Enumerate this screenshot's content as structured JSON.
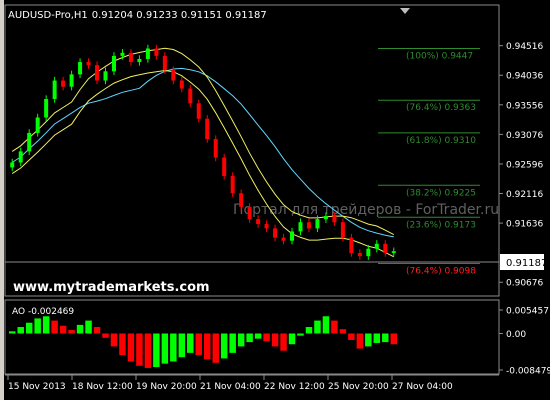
{
  "header": {
    "symbol": "AUDUSD-Pro,H1",
    "quotes": "0.91204 0.91233 0.91151 0.91187"
  },
  "watermark_text": "Портал для трейдеров - ForTrader.ru",
  "site_text": "www.mytrademarkets.com",
  "current_price": "0.91187",
  "main_axis": {
    "tick_labels": [
      "0.94516",
      "0.94036",
      "0.93556",
      "0.93076",
      "0.92596",
      "0.92116",
      "0.91636",
      "0.90676"
    ]
  },
  "fib_levels": [
    {
      "text": "(100%) 0.9447",
      "price": 0.9447,
      "color": "#2e8b2e"
    },
    {
      "text": "(76.4%) 0.9363",
      "price": 0.9363,
      "color": "#2e8b2e"
    },
    {
      "text": "(61.8%) 0.9310",
      "price": 0.931,
      "color": "#2e8b2e"
    },
    {
      "text": "(38.2%) 0.9225",
      "price": 0.9225,
      "color": "#2e8b2e"
    },
    {
      "text": "(23.6%) 0.9173",
      "price": 0.9173,
      "color": "#2e8b2e"
    },
    {
      "text": "(76.4%) 0.9098",
      "price": 0.9098,
      "color": "#ff2020"
    }
  ],
  "ao": {
    "label": "AO -0.002469",
    "tick_labels": [
      "0.005457",
      "0.00",
      "-0.008479"
    ]
  },
  "time_axis": {
    "labels": [
      "15 Nov 2013",
      "18 Nov 12:00",
      "19 Nov 20:00",
      "21 Nov 04:00",
      "22 Nov 12:00",
      "25 Nov 20:00",
      "27 Nov 04:00"
    ]
  },
  "colors": {
    "bull": "#00ff00",
    "bear": "#ff0000",
    "ma_slow": "#5fd7ff",
    "bands": "#f0f060",
    "axis_text": "#ffffff",
    "fib_green": "#2e8b2e",
    "fib_red": "#ff2020"
  },
  "chart_data": {
    "type": "candlestick",
    "title": "AUDUSD-Pro,H1",
    "y_range": [
      0.9055,
      0.949
    ],
    "close_series": [
      0.9262,
      0.928,
      0.931,
      0.9335,
      0.9365,
      0.9395,
      0.9385,
      0.9405,
      0.9425,
      0.942,
      0.9395,
      0.941,
      0.9435,
      0.944,
      0.9425,
      0.943,
      0.9447,
      0.9435,
      0.9412,
      0.9395,
      0.9382,
      0.9358,
      0.9333,
      0.93,
      0.927,
      0.924,
      0.9212,
      0.919,
      0.917,
      0.9162,
      0.9155,
      0.914,
      0.9135,
      0.915,
      0.9165,
      0.9155,
      0.917,
      0.9175,
      0.9165,
      0.914,
      0.9115,
      0.911,
      0.9122,
      0.913,
      0.9115,
      0.9118
    ],
    "ao_values": [
      0.0005,
      0.0015,
      0.0025,
      0.0035,
      0.004,
      0.003,
      0.0018,
      0.0008,
      0.002,
      0.003,
      0.0015,
      -0.001,
      -0.003,
      -0.005,
      -0.0065,
      -0.0075,
      -0.008,
      -0.0078,
      -0.007,
      -0.0065,
      -0.0055,
      -0.0045,
      -0.005,
      -0.006,
      -0.0068,
      -0.0058,
      -0.0045,
      -0.003,
      -0.002,
      -0.0012,
      -0.0018,
      -0.003,
      -0.004,
      -0.0025,
      -0.0005,
      0.0015,
      0.003,
      0.004,
      0.003,
      0.001,
      -0.0015,
      -0.0035,
      -0.003,
      -0.0022,
      -0.002,
      -0.0025
    ],
    "ao_range": [
      -0.008479,
      0.005457
    ]
  }
}
